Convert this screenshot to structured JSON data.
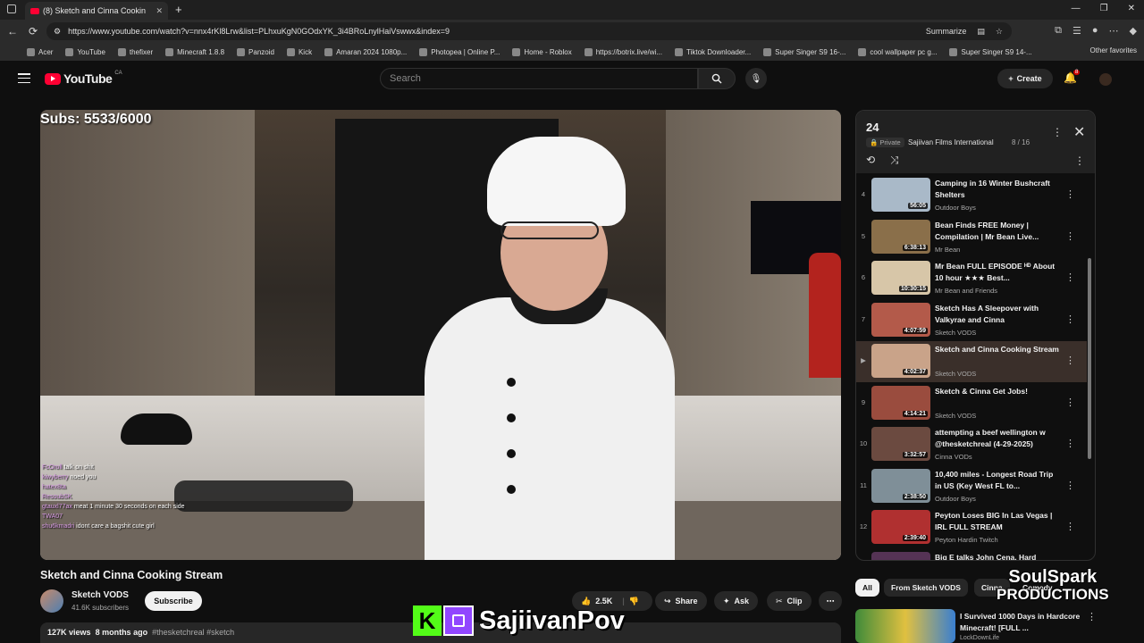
{
  "browser": {
    "tab_title": "(8) Sketch and Cinna Cookin",
    "url": "https://www.youtube.com/watch?v=nnx4rKl8Lrw&list=PLhxuKgN0GOdxYK_3i4BRoLnylHaiVswwx&index=9",
    "summarize": "Summarize",
    "bookmarks": [
      "Acer",
      "YouTube",
      "thefixer",
      "Minecraft 1.8.8",
      "Panzoid",
      "Kick",
      "Amaran 2024 1080p...",
      "Photopea | Online P...",
      "Home - Roblox",
      "https://botrix.live/wi...",
      "Tiktok Downloader...",
      "Super Singer S9 16-...",
      "cool wallpaper pc g...",
      "Super Singer S9 14-..."
    ],
    "other_favorites": "Other favorites"
  },
  "yt": {
    "logo": "YouTube",
    "country": "CA",
    "search_placeholder": "Search",
    "create": "Create",
    "notif_count": "8"
  },
  "video": {
    "subs_overlay": "Subs: 5533/6000",
    "chat": [
      {
        "user": "FcOroll",
        "msg": "talk on shit"
      },
      {
        "user": "kiwyberry",
        "msg": "noed you"
      },
      {
        "user": "hatex8ta",
        "msg": ""
      },
      {
        "user": "ResoubSK",
        "msg": ""
      },
      {
        "user": "gtauxl77ax",
        "msg": "meat 1 minute 30 seconds on each side"
      },
      {
        "user": "TWA07",
        "msg": ""
      },
      {
        "user": "shu6kmadri",
        "msg": "idont care a bagshit cute girl"
      }
    ],
    "title": "Sketch and Cinna Cooking Stream",
    "channel": "Sketch VODS",
    "subscribers": "41.6K subscribers",
    "subscribe": "Subscribe",
    "likes": "2.5K",
    "share": "Share",
    "ask": "Ask",
    "clip": "Clip",
    "views": "127K views",
    "age": "8 months ago",
    "tags": "#thesketchreal #sketch",
    "overlay_name": "SajiivanPov"
  },
  "playlist": {
    "title": "24",
    "privacy": "Private",
    "owner": "Sajiivan Films International",
    "position": "8 / 16",
    "items": [
      {
        "idx": "4",
        "title": "Camping in 16 Winter Bushcraft Shelters",
        "channel": "Outdoor Boys",
        "duration": "56:05",
        "color": "#a9b9c8"
      },
      {
        "idx": "5",
        "title": "Bean Finds FREE Money | Compilation | Mr Bean Live...",
        "channel": "Mr Bean",
        "duration": "6:38:13",
        "color": "#8a6f4a"
      },
      {
        "idx": "6",
        "title": "Mr Bean FULL EPISODE ᴴᴰ About 10 hour ★★★ Best...",
        "channel": "Mr Bean and Friends",
        "duration": "10:30:15",
        "color": "#d7c6a8"
      },
      {
        "idx": "7",
        "title": "Sketch Has A Sleepover with Valkyrae and Cinna",
        "channel": "Sketch VODS",
        "duration": "4:07:59",
        "color": "#b35a4a"
      },
      {
        "idx": "▶",
        "title": "Sketch and Cinna Cooking Stream",
        "channel": "Sketch VODS",
        "duration": "4:02:37",
        "color": "#c9a389"
      },
      {
        "idx": "9",
        "title": "Sketch & Cinna Get Jobs!",
        "channel": "Sketch VODS",
        "duration": "4:14:21",
        "color": "#9a4c3e"
      },
      {
        "idx": "10",
        "title": "attempting a beef wellington w @thesketchreal (4-29-2025)",
        "channel": "Cinna VODs",
        "duration": "3:32:57",
        "color": "#6b4a40"
      },
      {
        "idx": "11",
        "title": "10,400 miles - Longest Road Trip in US (Key West FL to...",
        "channel": "Outdoor Boys",
        "duration": "2:38:50",
        "color": "#7f8f98"
      },
      {
        "idx": "12",
        "title": "Peyton Loses BIG In Las Vegas | IRL FULL STREAM",
        "channel": "Peyton Hardin Twitch",
        "duration": "2:39:40",
        "color": "#b03030"
      },
      {
        "idx": "",
        "title": "Big E talks John Cena, Hard",
        "channel": "",
        "duration": "",
        "color": "#553355"
      }
    ]
  },
  "chips": [
    "All",
    "From Sketch VODS",
    "Cinna",
    "Comedy"
  ],
  "recommended": {
    "title": "I Survived 1000 Days in Hardcore Minecraft! [FULL ...",
    "channel": "LockDownLife"
  },
  "brand": {
    "line1": "SoulSpark",
    "line2": "PRODUCTIONS"
  }
}
